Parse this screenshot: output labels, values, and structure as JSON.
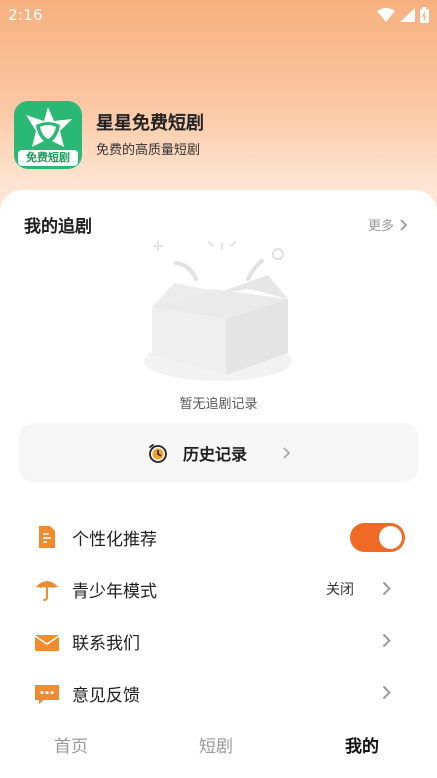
{
  "status_bar": {
    "time": "2:16",
    "icons": [
      "wifi-icon",
      "cellular-signal-icon",
      "battery-icon"
    ]
  },
  "app": {
    "name": "星星免费短剧",
    "description": "免费的高质量短剧",
    "logo_tag": "免费短剧"
  },
  "watchlist": {
    "title": "我的追剧",
    "more_label": "更多",
    "empty_text": "暂无追剧记录",
    "history_label": "历史记录"
  },
  "menu": {
    "items": [
      {
        "label": "个性化推荐",
        "icon": "document-icon",
        "toggle_on": true
      },
      {
        "label": "青少年模式",
        "icon": "umbrella-icon",
        "value": "关闭"
      },
      {
        "label": "联系我们",
        "icon": "mail-icon"
      },
      {
        "label": "意见反馈",
        "icon": "chat-icon"
      }
    ]
  },
  "tabs": [
    {
      "label": "首页",
      "active": false
    },
    {
      "label": "短剧",
      "active": false
    },
    {
      "label": "我的",
      "active": true
    }
  ],
  "colors": {
    "accent": "#f06a25",
    "logo_green": "#2bb774",
    "icon_orange": "#f28a2e"
  }
}
